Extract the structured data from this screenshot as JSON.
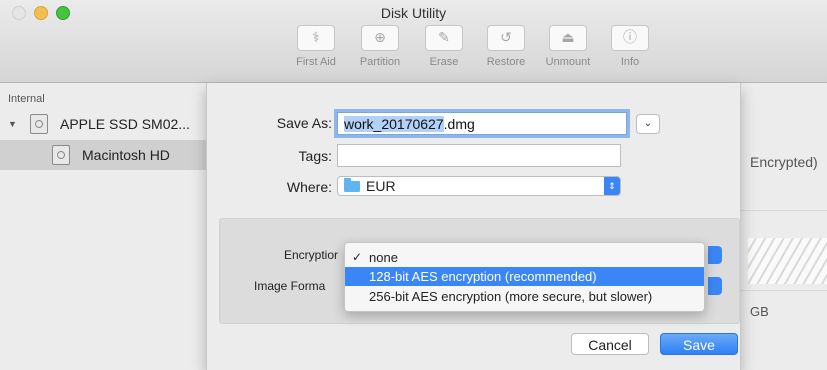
{
  "window": {
    "title": "Disk Utility"
  },
  "toolbar": {
    "items": [
      {
        "label": "First Aid",
        "icon": "stethoscope-icon",
        "glyph": "ℌ"
      },
      {
        "label": "Partition",
        "icon": "partition-icon",
        "glyph": "⊕"
      },
      {
        "label": "Erase",
        "icon": "erase-icon",
        "glyph": "⎚"
      },
      {
        "label": "Restore",
        "icon": "restore-icon",
        "glyph": "↺"
      },
      {
        "label": "Unmount",
        "icon": "eject-icon",
        "glyph": "⏏"
      },
      {
        "label": "Info",
        "icon": "info-icon",
        "glyph": "ⓘ"
      }
    ]
  },
  "sidebar": {
    "heading": "Internal",
    "disk": "APPLE SSD SM02...",
    "volume": "Macintosh HD"
  },
  "background": {
    "encrypted_note": "Encrypted)",
    "size_note": "GB"
  },
  "sheet": {
    "save_as_label": "Save As:",
    "save_as_selected": "work_20170627",
    "save_as_suffix": ".dmg",
    "tags_label": "Tags:",
    "tags_value": "",
    "where_label": "Where:",
    "where_value": "EUR",
    "encryption_label": "Encryptior",
    "image_format_label": "Image Forma",
    "encryption_menu": {
      "checked_index": 0,
      "highlighted_index": 1,
      "options": [
        "none",
        "128-bit AES encryption (recommended)",
        "256-bit AES encryption (more secure, but slower)"
      ]
    },
    "cancel_label": "Cancel",
    "save_label": "Save"
  },
  "colors": {
    "accent": "#3b86f7",
    "focus_ring": "#8fb6ea"
  }
}
